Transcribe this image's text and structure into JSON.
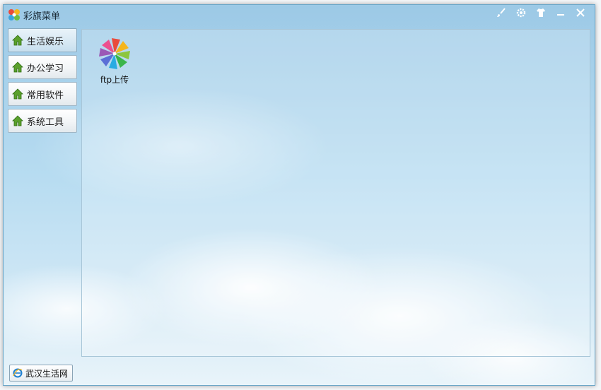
{
  "window": {
    "title": "彩旗菜单"
  },
  "titlebar": {
    "buttons": [
      {
        "icon": "brush-icon"
      },
      {
        "icon": "gear-icon"
      },
      {
        "icon": "shirt-icon"
      },
      {
        "icon": "minimize-icon"
      },
      {
        "icon": "close-icon"
      }
    ]
  },
  "nav": {
    "items": [
      {
        "label": "生活娱乐",
        "active": true
      },
      {
        "label": "办公学习",
        "active": false
      },
      {
        "label": "常用软件",
        "active": false
      },
      {
        "label": "系统工具",
        "active": false
      }
    ]
  },
  "content": {
    "apps": [
      {
        "label": "ftp上传",
        "icon": "pinwheel-icon"
      }
    ]
  },
  "footer": {
    "link_label": "武汉生活网",
    "icon": "ie-icon"
  },
  "colors": {
    "accent": "#9cc9e6",
    "border": "#6aa6c8"
  }
}
